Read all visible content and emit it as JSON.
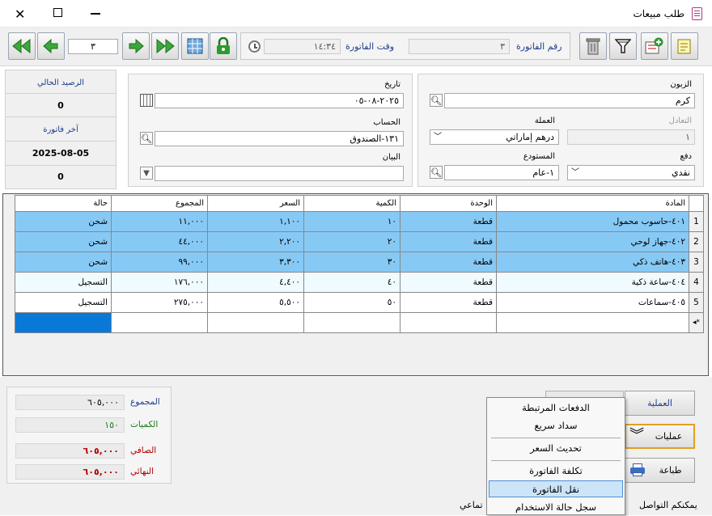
{
  "window": {
    "title": "طلب مبيعات"
  },
  "toolbar": {
    "invoice_number_label": "رقم الفاتورة",
    "invoice_number": "٣",
    "invoice_time_label": "وقت الفاتورة",
    "invoice_time": "١٤:٣٤",
    "nav_record": "٣"
  },
  "customer": {
    "customer_label": "الزبون",
    "customer": "كرم",
    "currency_label": "العملة",
    "currency": "درهم إماراتي",
    "rate_label": "التعادل",
    "rate": "١",
    "payment_label": "دفع",
    "payment": "نقدي",
    "warehouse_label": "المستودع",
    "warehouse": "١-عام"
  },
  "invoice": {
    "date_label": "تاريخ",
    "date": "٢٠٢٥-٠٨-٠٥",
    "account_label": "الحساب",
    "account": "١٣١-الصندوق",
    "statement_label": "البيان",
    "statement": ""
  },
  "balance": {
    "current_balance_label": "الرصيد الحالي",
    "current_balance": "0",
    "last_invoice_label": "آخر فاتورة",
    "last_invoice_date": "2025-08-05",
    "last_invoice_value": "0"
  },
  "grid": {
    "headers": {
      "item": "المادة",
      "unit": "الوحدة",
      "qty": "الكمية",
      "price": "السعر",
      "total": "المجموع",
      "status": "حالة"
    },
    "rows": [
      {
        "n": "1",
        "item": "٤٠١-حاسوب محمول",
        "unit": "قطعة",
        "qty": "١٠",
        "price": "١,١٠٠",
        "total": "١١,٠٠٠",
        "status": "شحن"
      },
      {
        "n": "2",
        "item": "٤٠٢-جهاز لوحي",
        "unit": "قطعة",
        "qty": "٢٠",
        "price": "٢,٢٠٠",
        "total": "٤٤,٠٠٠",
        "status": "شحن"
      },
      {
        "n": "3",
        "item": "٤٠٣-هاتف ذكي",
        "unit": "قطعة",
        "qty": "٣٠",
        "price": "٣,٣٠٠",
        "total": "٩٩,٠٠٠",
        "status": "شحن"
      },
      {
        "n": "4",
        "item": "٤٠٤-ساعة ذكية",
        "unit": "قطعة",
        "qty": "٤٠",
        "price": "٤,٤٠٠",
        "total": "١٧٦,٠٠٠",
        "status": "التسجيل"
      },
      {
        "n": "5",
        "item": "٤٠٥-سماعات",
        "unit": "قطعة",
        "qty": "٥٠",
        "price": "٥,٥٠٠",
        "total": "٢٧٥,٠٠٠",
        "status": "التسجيل"
      }
    ],
    "new_row_marker": "*◂"
  },
  "totals": {
    "total_label": "المجموع",
    "total": "٦٠٥,٠٠٠",
    "qty_label": "الكميات",
    "qty": "١٥٠",
    "net_label": "الصافي",
    "net": "٦٠٥,٠٠٠",
    "final_label": "النهائي",
    "final": "٦٠٥,٠٠٠"
  },
  "buttons": {
    "process": "العملية",
    "operations": "عمليات",
    "print": "طباعة"
  },
  "menu": {
    "items": [
      "الدفعات المرتبطة",
      "سداد سريع",
      "تحديث السعر",
      "تكلفة الفاتورة",
      "نقل الفاتورة",
      "سجل حالة الاستخدام"
    ]
  },
  "status_bar": {
    "left": "يمكنكم التواصل",
    "right": "تماعي"
  },
  "colors": {
    "selected_row": "#87c9f5",
    "accent_blue": "#0a5bc4",
    "label_blue": "#1e3c8c",
    "net_red": "#b40000"
  }
}
